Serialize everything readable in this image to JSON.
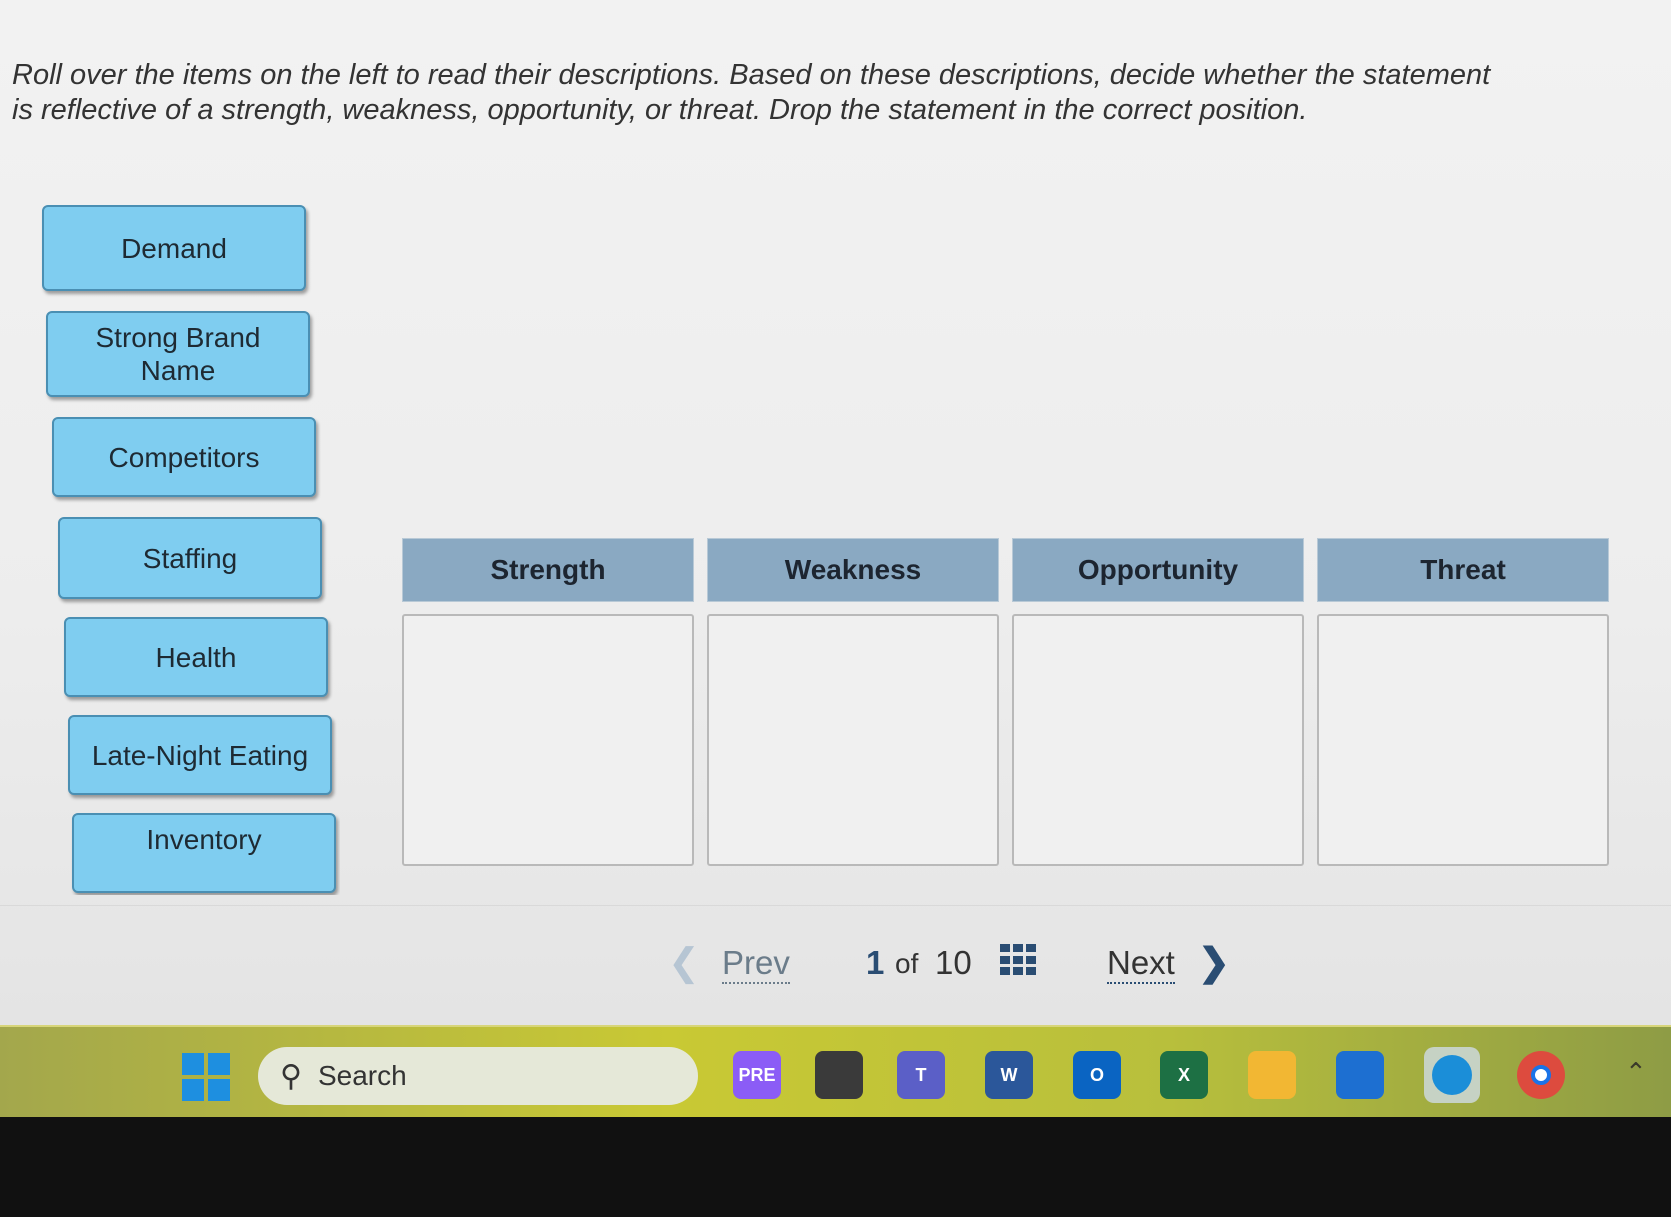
{
  "instructions": "Roll over the items on the left to read their descriptions. Based on these descriptions, decide whether the statement is reflective of a strength, weakness, opportunity, or threat. Drop the statement in the correct position.",
  "items": [
    {
      "label": "Demand"
    },
    {
      "label": "Strong Brand Name"
    },
    {
      "label": "Competitors"
    },
    {
      "label": "Staffing"
    },
    {
      "label": "Health"
    },
    {
      "label": "Late-Night Eating"
    },
    {
      "label": "Inventory"
    }
  ],
  "columns": [
    {
      "header": "Strength"
    },
    {
      "header": "Weakness"
    },
    {
      "header": "Opportunity"
    },
    {
      "header": "Threat"
    }
  ],
  "pager": {
    "prev_label": "Prev",
    "current": "1",
    "of": "of",
    "total": "10",
    "next_label": "Next"
  },
  "taskbar": {
    "search_placeholder": "Search",
    "apps": [
      {
        "name": "windows-start",
        "color": "#1e8fe0"
      },
      {
        "name": "copilot-pre",
        "label": "PRE",
        "color": "#8b5cf6"
      },
      {
        "name": "task-view",
        "color": "#3a3a3a"
      },
      {
        "name": "teams",
        "label": "T",
        "color": "#5b5fc7"
      },
      {
        "name": "word",
        "label": "W",
        "color": "#2b579a"
      },
      {
        "name": "outlook",
        "label": "O",
        "color": "#0a64c2"
      },
      {
        "name": "excel",
        "label": "X",
        "color": "#1d7044"
      },
      {
        "name": "file-explorer",
        "color": "#f2b733"
      },
      {
        "name": "microsoft-store",
        "color": "#1d6fd1"
      },
      {
        "name": "edge",
        "color": "#1b8ed8"
      },
      {
        "name": "chrome",
        "color": "#dd4b3e"
      }
    ]
  }
}
